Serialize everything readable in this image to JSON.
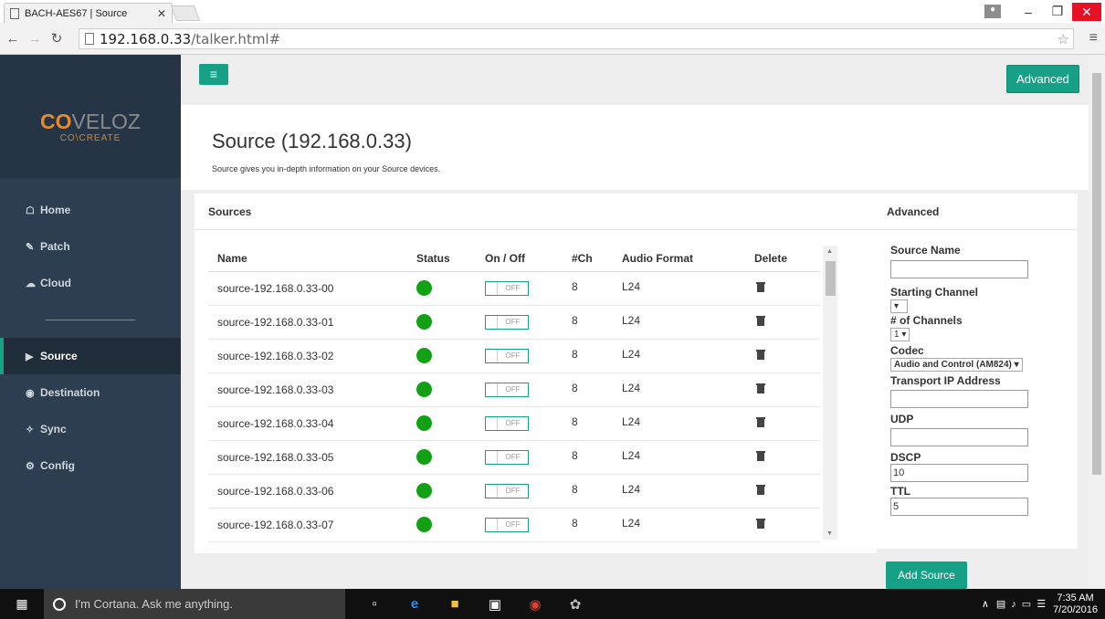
{
  "browser": {
    "tab_title": "BACH-AES67 | Source",
    "url_host": "192.168.0.33",
    "url_path": "/talker.html#"
  },
  "sidebar": {
    "logo_main_a": "CO",
    "logo_main_b": "VELOZ",
    "logo_sub": "CO\\CREATE",
    "items": [
      {
        "label": "Home",
        "icon": "home-icon"
      },
      {
        "label": "Patch",
        "icon": "edit-icon"
      },
      {
        "label": "Cloud",
        "icon": "cloud-icon"
      },
      {
        "label": "Source",
        "icon": "source-icon"
      },
      {
        "label": "Destination",
        "icon": "destination-icon"
      },
      {
        "label": "Sync",
        "icon": "sync-icon"
      },
      {
        "label": "Config",
        "icon": "gear-icon"
      }
    ]
  },
  "header": {
    "advanced_button": "Advanced",
    "title": "Source (192.168.0.33)",
    "subtitle": "Source gives you in-depth information on your Source devices."
  },
  "sources": {
    "panel_title": "Sources",
    "columns": [
      "Name",
      "Status",
      "On / Off",
      "#Ch",
      "Audio Format",
      "Delete"
    ],
    "toggle_label": "OFF",
    "rows": [
      {
        "name": "source-192.168.0.33-00",
        "ch": "8",
        "format": "L24"
      },
      {
        "name": "source-192.168.0.33-01",
        "ch": "8",
        "format": "L24"
      },
      {
        "name": "source-192.168.0.33-02",
        "ch": "8",
        "format": "L24"
      },
      {
        "name": "source-192.168.0.33-03",
        "ch": "8",
        "format": "L24"
      },
      {
        "name": "source-192.168.0.33-04",
        "ch": "8",
        "format": "L24"
      },
      {
        "name": "source-192.168.0.33-05",
        "ch": "8",
        "format": "L24"
      },
      {
        "name": "source-192.168.0.33-06",
        "ch": "8",
        "format": "L24"
      },
      {
        "name": "source-192.168.0.33-07",
        "ch": "8",
        "format": "L24"
      }
    ]
  },
  "advanced": {
    "panel_title": "Advanced",
    "source_name_label": "Source Name",
    "source_name_value": "",
    "starting_channel_label": "Starting Channel",
    "starting_channel_value": "",
    "num_channels_label": "# of Channels",
    "num_channels_value": "1",
    "codec_label": "Codec",
    "codec_value": "Audio and Control (AM824)",
    "transport_ip_label": "Transport IP Address",
    "transport_ip_value": "",
    "udp_label": "UDP",
    "udp_value": "",
    "dscp_label": "DSCP",
    "dscp_value": "10",
    "ttl_label": "TTL",
    "ttl_value": "5",
    "add_button": "Add Source"
  },
  "taskbar": {
    "cortana_text": "I'm Cortana. Ask me anything.",
    "time": "7:35 AM",
    "date": "7/20/2016"
  }
}
